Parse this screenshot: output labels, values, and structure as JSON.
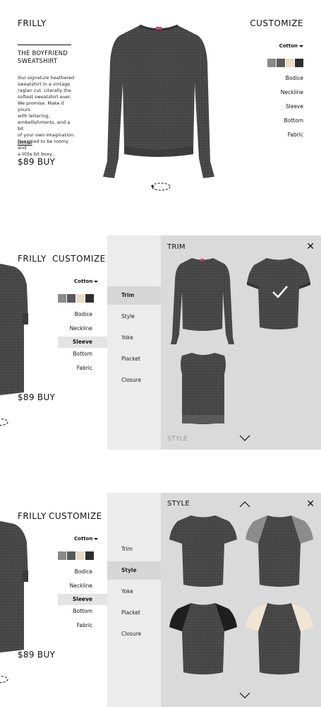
{
  "brand": "FRILLY",
  "customize": "CUSTOMIZE",
  "product": {
    "title_line1": "THE BOYFRIEND",
    "title_line2": "SWEATSHIRT",
    "description": [
      "Our signature heathered",
      "sweatshirt in a vintage",
      "raglan cut. Literally the",
      "softest sweatshirt ever.",
      "We promise. Make it yours",
      "with lettering,",
      "embellishments, and a bit",
      "of your own imagination.",
      "Designed to be roomy and",
      "a little bit boxy..."
    ],
    "detail_link": "Detail",
    "price_buy": "$89 BUY"
  },
  "material": {
    "selected": "Cotton"
  },
  "swatch_colors": [
    "#8a8a8a",
    "#5a5a5a",
    "#e8dcc6",
    "#2e2e2e"
  ],
  "options": [
    "Bodice",
    "Neckline",
    "Sleeve",
    "Bottom",
    "Fabric"
  ],
  "screen2": {
    "active_option": "Sleeve",
    "menu": [
      "Trim",
      "Style",
      "Yoke",
      "Placket",
      "Closure"
    ],
    "active_menu": "Trim",
    "panel_title": "TRIM",
    "next_label": "STYLE"
  },
  "screen3": {
    "active_option": "Sleeve",
    "menu": [
      "Trim",
      "Style",
      "Yoke",
      "Placket",
      "Closure"
    ],
    "active_menu": "Style",
    "panel_title": "STYLE"
  },
  "colors": {
    "sweater": "#484848",
    "panel_menu": "#ececec",
    "panel_grid": "#dadada",
    "cream": "#efe5d2",
    "black": "#1e1e1e",
    "gray_sleeve": "#8c8c8c"
  }
}
